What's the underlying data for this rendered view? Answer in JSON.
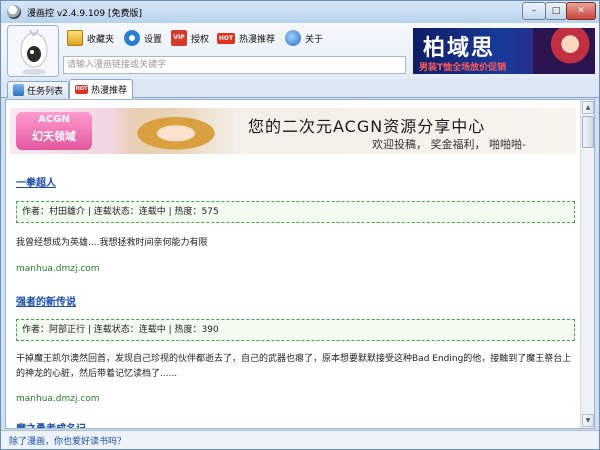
{
  "window": {
    "title": "漫画控 v2.4.9.109 [免费版]",
    "controls": {
      "minimize": "–",
      "maximize": "□",
      "close": "✕"
    }
  },
  "toolbar": {
    "items": [
      {
        "label": "收藏夹",
        "icon": "favorites-folder-icon"
      },
      {
        "label": "设置",
        "icon": "gear-icon"
      },
      {
        "label": "授权",
        "icon": "vip-icon",
        "icon_text": "VIP"
      },
      {
        "label": "热漫推荐",
        "icon": "hot-badge-icon",
        "icon_text": "HOT"
      },
      {
        "label": "关于",
        "icon": "about-icon"
      }
    ]
  },
  "search": {
    "placeholder": "请输入漫画链接或关键字",
    "value": ""
  },
  "ad": {
    "title": "柏域思",
    "subtitle": "男装T恤全场放价促销"
  },
  "tabs": [
    {
      "label": "任务列表",
      "icon": "download-icon",
      "active": false
    },
    {
      "label": "热漫推荐",
      "icon": "hot-badge-icon",
      "icon_text": "HOT",
      "active": true
    }
  ],
  "banner": {
    "logo_line1": "ACGN",
    "logo_line2": "幻天领域",
    "headline": "您的二次元ACGN资源分享中心",
    "subline": "欢迎投稿， 奖金福利， 啪啪啪-"
  },
  "entries": [
    {
      "title": "一拳超人",
      "meta": "作者：村田雄介 | 连载状态：连载中 | 热度：575",
      "description": "我曾经想成为英雄....我想拯救时间亲何能力有限",
      "source": "manhua.dmzj.com"
    },
    {
      "title": "强者的新传说",
      "meta": "作者：阿部正行 | 连载状态：连载中 | 热度：390",
      "description": "干掉魔王凯尔澳然回首，发现自己珍视的伙伴都逝去了，自己的武器也瘪了，原本想要默默接受这种Bad Ending的他，接触到了魔王祭台上的神龙的心脏，然后带着记忆读档了......",
      "source": "manhua.dmzj.com"
    },
    {
      "title": "魔之勇者成名记"
    }
  ],
  "status": {
    "link_text": "除了漫画，你也爱好读书吗？"
  },
  "colors": {
    "accent": "#1a4fa8",
    "meta_border": "#3fa83f",
    "source_text": "#2a7a2a"
  }
}
